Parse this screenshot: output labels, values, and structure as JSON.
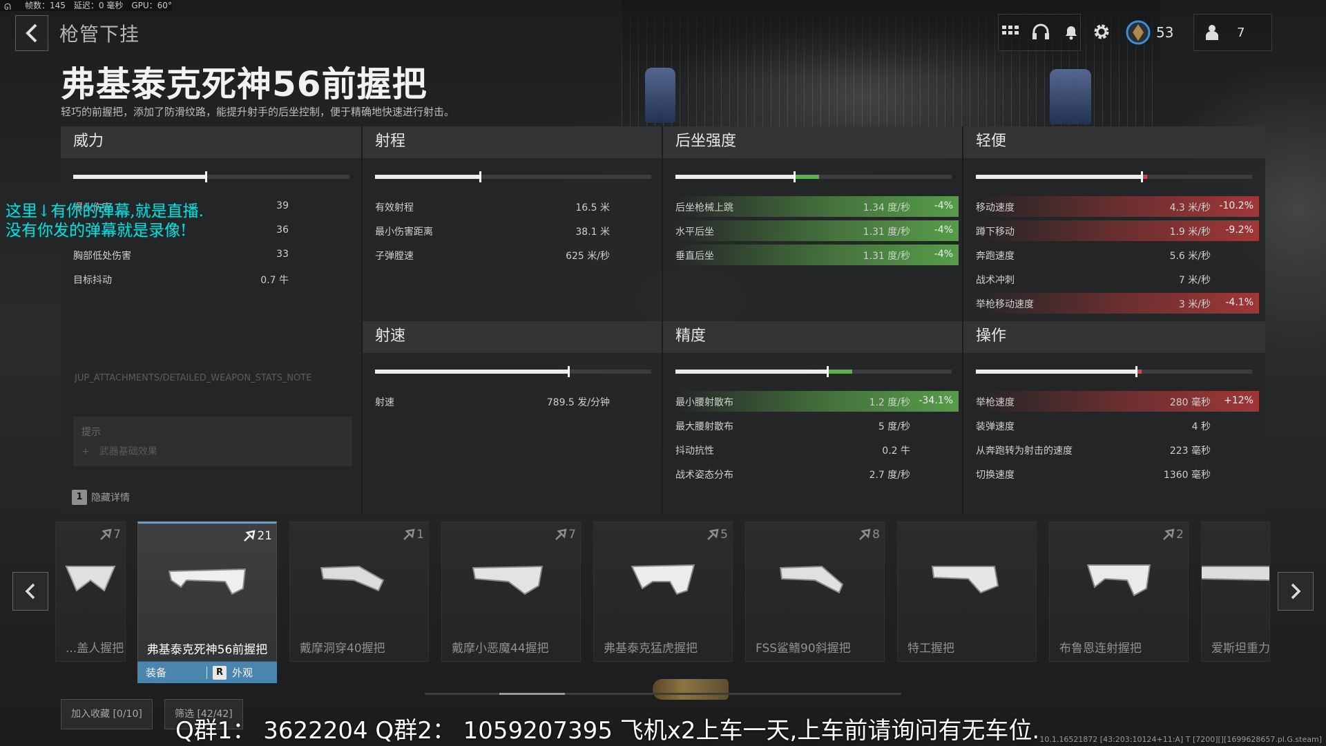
{
  "fps_overlay": {
    "text": "帧数：145　延迟：0 毫秒　GPU：60°"
  },
  "header": {
    "breadcrumb": "枪管下挂",
    "title": "弗基泰克死神56前握把",
    "description": "轻巧的前握把，添加了防滑纹路，能提升射手的后坐控制，便于精确地快速进行射击。"
  },
  "topbar": {
    "level": "53",
    "party_count": "7"
  },
  "sections": {
    "power": {
      "title": "威力",
      "bar_fill": 0.48,
      "rows": [
        {
          "label": "爆头伤害",
          "value": "39"
        },
        {
          "label": "",
          "value": "36"
        },
        {
          "label": "胸部低处伤害",
          "value": "33"
        },
        {
          "label": "目标抖动",
          "value": "0.7 牛"
        }
      ]
    },
    "range": {
      "title": "射程",
      "bar_fill": 0.38,
      "rows": [
        {
          "label": "有效射程",
          "value": "16.5 米"
        },
        {
          "label": "最小伤害距离",
          "value": "38.1 米"
        },
        {
          "label": "子弹膛速",
          "value": "625 米/秒"
        }
      ]
    },
    "recoil": {
      "title": "后坐强度",
      "bar_fill": 0.43,
      "rows": [
        {
          "label": "后坐枪械上跳",
          "value": "1.34 度/秒",
          "pct": "-4%",
          "state": "good"
        },
        {
          "label": "水平后坐",
          "value": "1.31 度/秒",
          "pct": "-4%",
          "state": "good"
        },
        {
          "label": "垂直后坐",
          "value": "1.31 度/秒",
          "pct": "-4%",
          "state": "good"
        }
      ]
    },
    "mobility": {
      "title": "轻便",
      "bar_fill": 0.6,
      "rows": [
        {
          "label": "移动速度",
          "value": "4.3 米/秒",
          "pct": "-10.2%",
          "state": "bad"
        },
        {
          "label": "蹲下移动",
          "value": "1.9 米/秒",
          "pct": "-9.2%",
          "state": "bad"
        },
        {
          "label": "奔跑速度",
          "value": "5.6 米/秒",
          "pct": "",
          "state": ""
        },
        {
          "label": "战术冲刺",
          "value": "7 米/秒",
          "pct": "",
          "state": ""
        },
        {
          "label": "举枪移动速度",
          "value": "3 米/秒",
          "pct": "-4.1%",
          "state": "bad"
        }
      ]
    },
    "firerate": {
      "title": "射速",
      "bar_fill": 0.7,
      "rows": [
        {
          "label": "射速",
          "value": "789.5 发/分钟"
        }
      ]
    },
    "accuracy": {
      "title": "精度",
      "bar_fill": 0.55,
      "rows": [
        {
          "label": "最小腰射散布",
          "value": "1.2 度/秒",
          "pct": "-34.1%",
          "state": "good"
        },
        {
          "label": "最大腰射散布",
          "value": "5 度/秒",
          "pct": "",
          "state": ""
        },
        {
          "label": "抖动抗性",
          "value": "0.2 牛",
          "pct": "",
          "state": ""
        },
        {
          "label": "战术姿态分布",
          "value": "2.7 度/秒",
          "pct": "",
          "state": ""
        }
      ]
    },
    "handling": {
      "title": "操作",
      "bar_fill": 0.58,
      "rows": [
        {
          "label": "举枪速度",
          "value": "280 毫秒",
          "pct": "+12%",
          "state": "bad"
        },
        {
          "label": "装弹速度",
          "value": "4 秒",
          "pct": "",
          "state": ""
        },
        {
          "label": "从奔跑转为射击的速度",
          "value": "223 毫秒",
          "pct": "",
          "state": ""
        },
        {
          "label": "切换速度",
          "value": "1360 毫秒",
          "pct": "",
          "state": ""
        }
      ]
    }
  },
  "note": "JUP_ATTACHMENTS/DETAILED_WEAPON_STATS_NOTE",
  "tip": {
    "title": "提示",
    "line": "武器基础效果"
  },
  "hide_details": {
    "key": "1",
    "label": "隐藏详情"
  },
  "danmaku": [
    "这里↓有你的弹幕,就是直播.",
    "没有你发的弹幕就是录像!"
  ],
  "attachments": [
    {
      "name": "...盖人握把",
      "count": "7",
      "selected": false
    },
    {
      "name": "弗基泰克死神56前握把",
      "count": "21",
      "selected": true
    },
    {
      "name": "戴摩洞穿40握把",
      "count": "1",
      "selected": false
    },
    {
      "name": "戴摩小恶魔44握把",
      "count": "7",
      "selected": false
    },
    {
      "name": "弗基泰克猛虎握把",
      "count": "5",
      "selected": false
    },
    {
      "name": "FSS鲨鳍90斜握把",
      "count": "8",
      "selected": false
    },
    {
      "name": "特工握把",
      "count": "",
      "selected": false
    },
    {
      "name": "布鲁恩连射握把",
      "count": "2",
      "selected": false
    },
    {
      "name": "爱斯坦重力",
      "count": "",
      "selected": false
    }
  ],
  "equip_bar": {
    "equip": "装备",
    "key": "R",
    "appearance": "外观"
  },
  "buttons": {
    "favorite": "加入收藏 [0/10]",
    "filter": "筛选 [42/42]"
  },
  "qq_text": "Q群1：  3622204     Q群2：  1059207395      飞机x2上车一天,上车前请询问有无车位.",
  "debug_text": "10.1.16521872 [43:203:10124+11:A] T [7200][][1699628657.pl.G.steam]",
  "colors": {
    "accent": "#4a85ae",
    "good": "#5fb14f",
    "bad": "#c94b4b",
    "danmaku": "#00e1e1"
  }
}
